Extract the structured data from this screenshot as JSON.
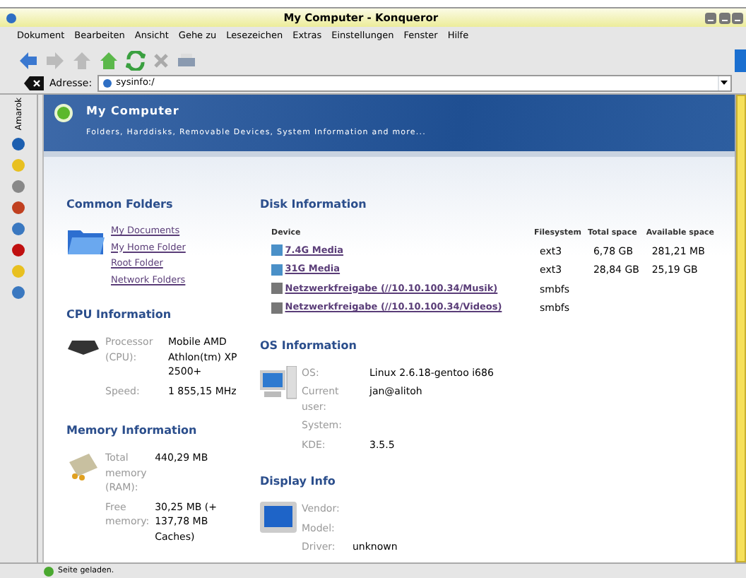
{
  "window": {
    "title": "My Computer - Konqueror"
  },
  "menu": [
    "Dokument",
    "Bearbeiten",
    "Ansicht",
    "Gehe zu",
    "Lesezeichen",
    "Extras",
    "Einstellungen",
    "Fenster",
    "Hilfe"
  ],
  "address": {
    "label": "Adresse:",
    "value": "sysinfo:/"
  },
  "sidebar": {
    "tab_label": "Amarok"
  },
  "header": {
    "title": "My Computer",
    "subtitle": "Folders, Harddisks, Removable Devices, System Information and more..."
  },
  "common_folders": {
    "title": "Common Folders",
    "links": [
      "My Documents",
      "My Home Folder",
      "Root Folder",
      "Network Folders"
    ]
  },
  "disk_information": {
    "title": "Disk Information",
    "columns": [
      "Device",
      "Filesystem",
      "Total space",
      "Available space"
    ],
    "rows": [
      {
        "kind": "local",
        "device": "7.4G Media",
        "filesystem": "ext3",
        "total": "6,78 GB",
        "available": "281,21 MB"
      },
      {
        "kind": "local",
        "device": "31G Media",
        "filesystem": "ext3",
        "total": "28,84 GB",
        "available": "25,19 GB"
      },
      {
        "kind": "network",
        "device": "Netzwerkfreigabe (//10.10.100.34/Musik)",
        "filesystem": "smbfs"
      },
      {
        "kind": "network",
        "device": "Netzwerkfreigabe (//10.10.100.34/Videos)",
        "filesystem": "smbfs"
      }
    ]
  },
  "cpu_information": {
    "title": "CPU Information",
    "rows": [
      {
        "label": "Processor (CPU):",
        "value": "Mobile AMD Athlon(tm) XP 2500+"
      },
      {
        "label": "Speed:",
        "value": "1 855,15 MHz"
      }
    ]
  },
  "memory_information": {
    "title": "Memory Information",
    "rows": [
      {
        "label": "Total memory (RAM):",
        "value": "440,29 MB"
      },
      {
        "label": "Free memory:",
        "value": "30,25 MB (+ 137,78 MB Caches)"
      }
    ]
  },
  "os_information": {
    "title": "OS Information",
    "rows": [
      {
        "label": "OS:",
        "value": "Linux 2.6.18-gentoo i686"
      },
      {
        "label": "Current user:",
        "value": "jan@alitoh"
      },
      {
        "label": "System:"
      },
      {
        "label": "KDE:",
        "value": "3.5.5"
      }
    ]
  },
  "display_info": {
    "title": "Display Info",
    "rows": [
      {
        "label": "Vendor:"
      },
      {
        "label": "Model:"
      },
      {
        "label": "Driver:",
        "value": "unknown"
      }
    ]
  },
  "status_bar": {
    "text": "Seite geladen."
  }
}
